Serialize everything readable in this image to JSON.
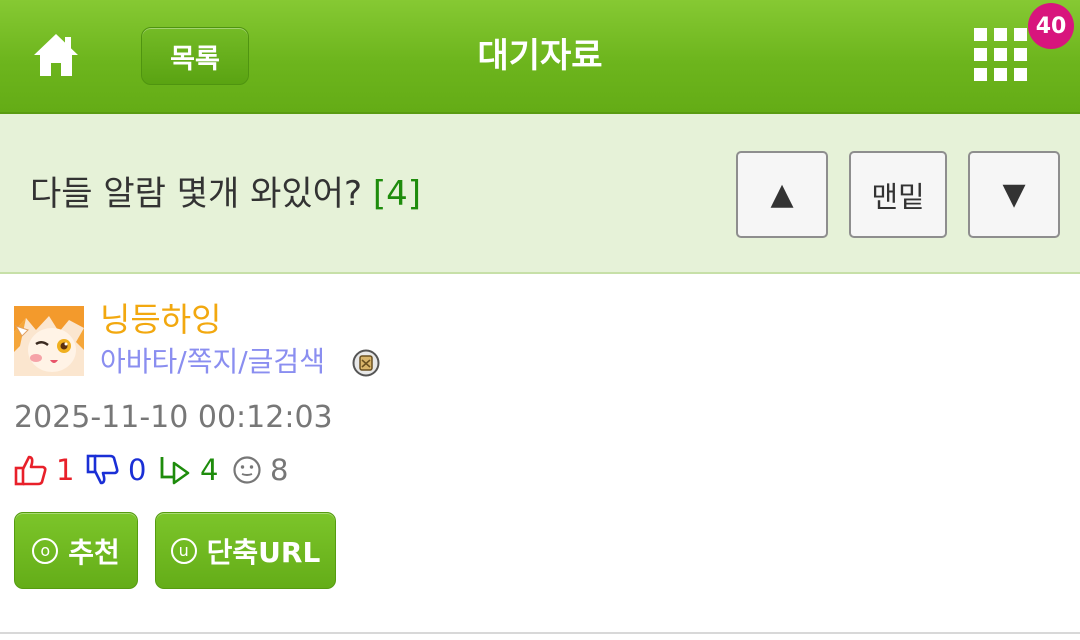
{
  "header": {
    "list_label": "목록",
    "title": "대기자료",
    "badge_count": "40",
    "home_icon": "home-icon",
    "menu_icon": "grid-menu-icon"
  },
  "post": {
    "title": "다들 알람 몇개 와있어?",
    "comment_count": "[4]",
    "nav": {
      "up": "▲",
      "bottom": "맨밑",
      "down": "▼"
    }
  },
  "author": {
    "nickname": "닝등하잉",
    "links": "아바타/쪽지/글검색",
    "datetime": "2025-11-10 00:12:03"
  },
  "stats": {
    "likes": "1",
    "dislikes": "0",
    "comments": "4",
    "views": "8"
  },
  "actions": {
    "recommend_key": "o",
    "recommend": "추천",
    "shorturl_key": "u",
    "shorturl": "단축URL"
  },
  "colors": {
    "header_green": "#6db51d",
    "title_bar": "#e6f2d8",
    "badge": "#d8157d",
    "nickname": "#f2a80f",
    "links": "#8a8ef0",
    "like": "#e8202a",
    "dislike": "#1a2fd6",
    "comment": "#1e8c0c",
    "view": "#777777"
  }
}
